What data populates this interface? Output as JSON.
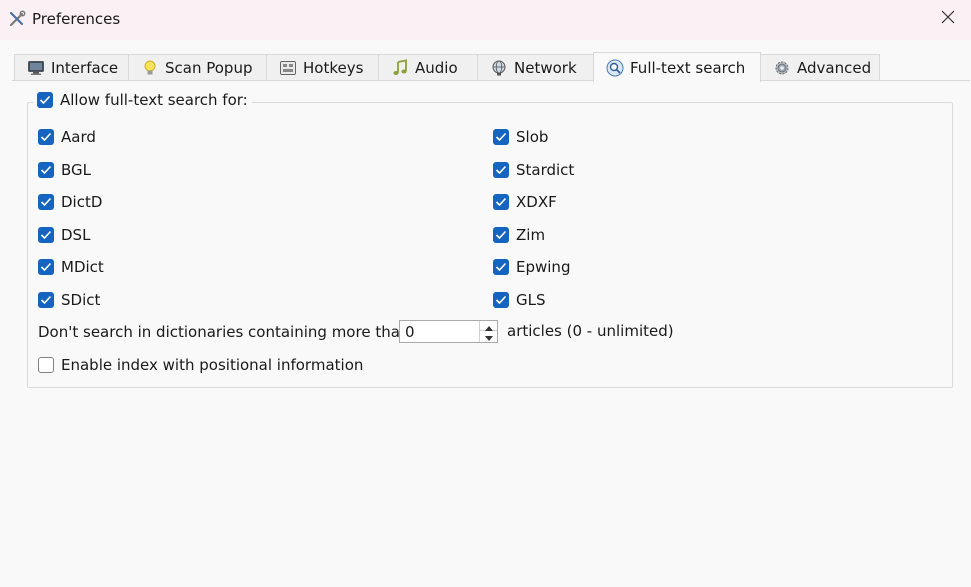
{
  "window": {
    "title": "Preferences"
  },
  "tabs": [
    {
      "label": "Interface",
      "icon": "monitor-icon"
    },
    {
      "label": "Scan Popup",
      "icon": "lightbulb-icon"
    },
    {
      "label": "Hotkeys",
      "icon": "keyboard-icon"
    },
    {
      "label": "Audio",
      "icon": "music-note-icon"
    },
    {
      "label": "Network",
      "icon": "network-globe-icon"
    },
    {
      "label": "Full-text search",
      "icon": "magnifier-icon",
      "active": true
    },
    {
      "label": "Advanced",
      "icon": "gear-icon"
    }
  ],
  "fulltext": {
    "group_label": "Allow full-text search for:",
    "group_checked": true,
    "left_formats": [
      {
        "label": "Aard",
        "checked": true
      },
      {
        "label": "BGL",
        "checked": true
      },
      {
        "label": "DictD",
        "checked": true
      },
      {
        "label": "DSL",
        "checked": true
      },
      {
        "label": "MDict",
        "checked": true
      },
      {
        "label": "SDict",
        "checked": true
      }
    ],
    "right_formats": [
      {
        "label": "Slob",
        "checked": true
      },
      {
        "label": "Stardict",
        "checked": true
      },
      {
        "label": "XDXF",
        "checked": true
      },
      {
        "label": "Zim",
        "checked": true
      },
      {
        "label": "Epwing",
        "checked": true
      },
      {
        "label": "GLS",
        "checked": true
      }
    ],
    "max_articles_label": "Don't search in dictionaries containing more than",
    "max_articles_value": "0",
    "max_articles_suffix": "articles (0 - unlimited)",
    "positional_label": "Enable index with positional information",
    "positional_checked": false
  },
  "colors": {
    "accent": "#1565c0",
    "titlebar_bg": "#fbf1f4",
    "window_bg": "#f9f9f9"
  }
}
